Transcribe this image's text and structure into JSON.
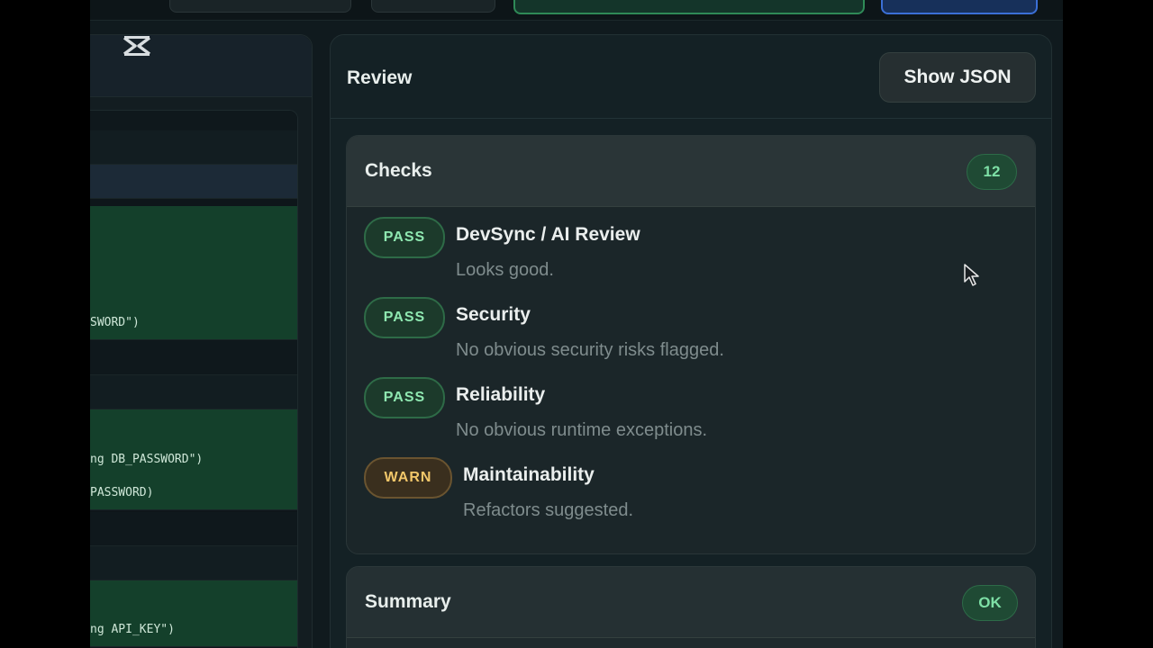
{
  "review_panel": {
    "title": "Review",
    "show_json_label": "Show JSON"
  },
  "checks": {
    "title": "Checks",
    "count": "12",
    "items": [
      {
        "status": "PASS",
        "name": "DevSync / AI Review",
        "description": "Looks good."
      },
      {
        "status": "PASS",
        "name": "Security",
        "description": "No obvious security risks flagged."
      },
      {
        "status": "PASS",
        "name": "Reliability",
        "description": "No obvious runtime exceptions."
      },
      {
        "status": "WARN",
        "name": "Maintainability",
        "description": "Refactors suggested."
      }
    ]
  },
  "summary": {
    "title": "Summary",
    "status": "OK"
  },
  "code_panel": {
    "lines": [
      "SWORD\")",
      "ng DB_PASSWORD\")",
      "PASSWORD)",
      "ng API_KEY\")"
    ]
  },
  "icons": {
    "logo": "capcut-logo-icon",
    "cursor": "mouse-pointer-icon"
  },
  "colors": {
    "pass": "#8fe8b1",
    "warn": "#f2c76a",
    "accent_green": "#2f8a57",
    "accent_blue": "#3b6fd6"
  }
}
